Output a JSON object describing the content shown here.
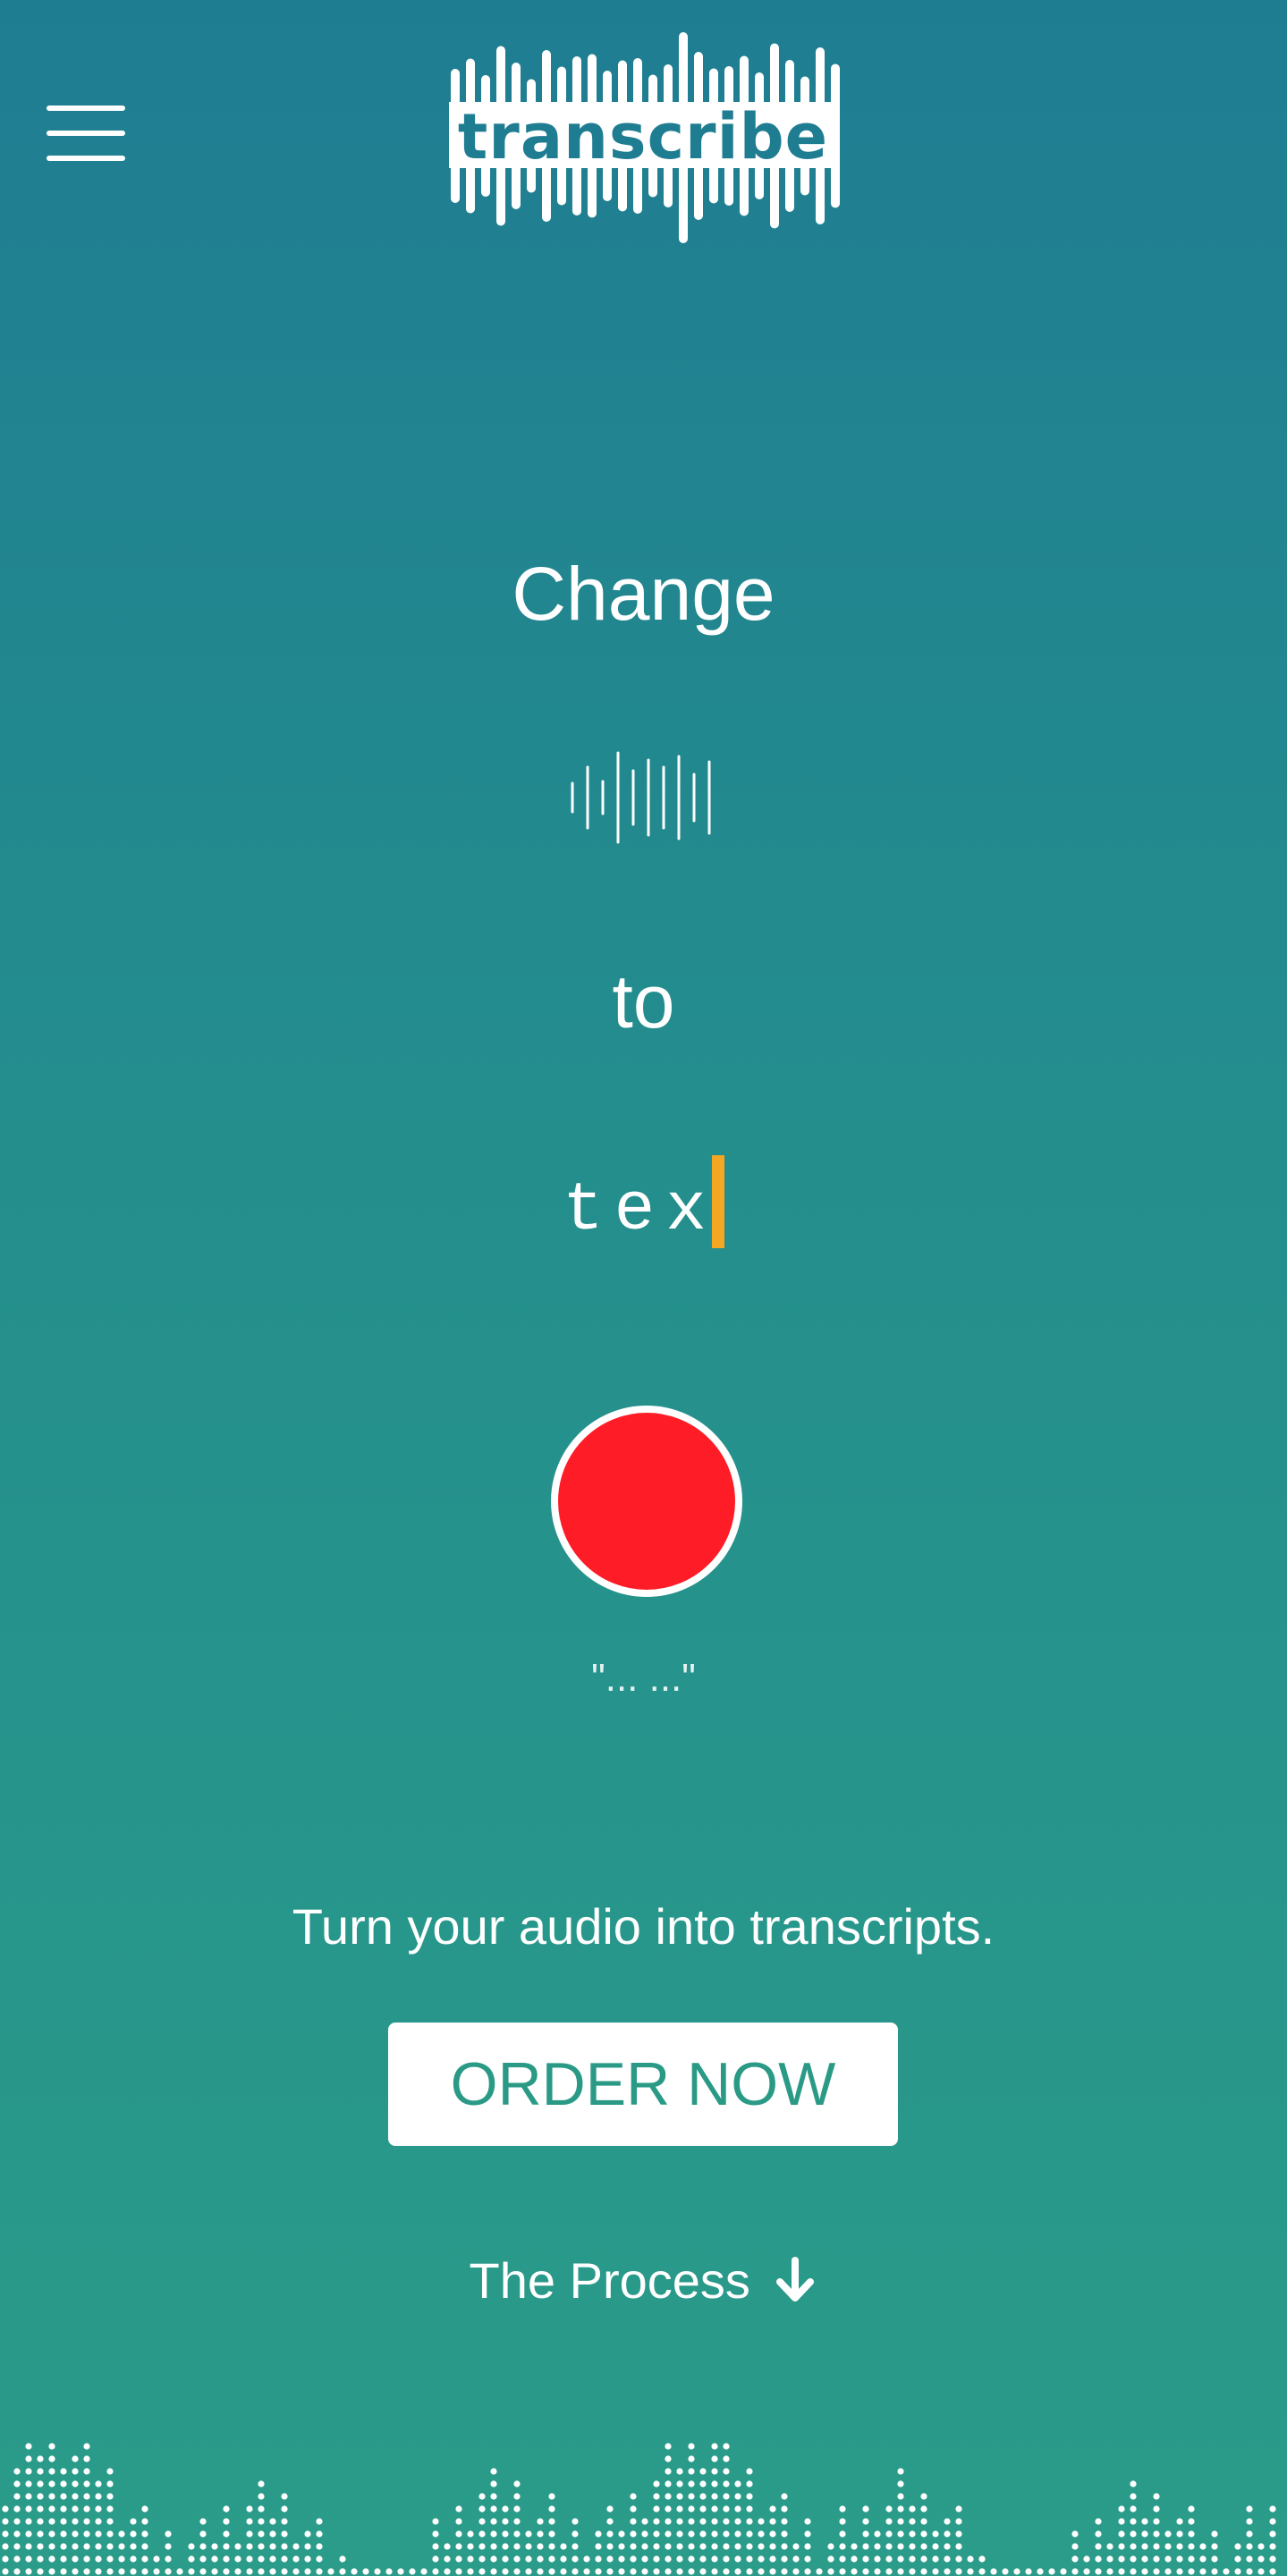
{
  "header": {
    "menu_icon": "hamburger-menu-icon",
    "logo_text": "transcribe"
  },
  "hero": {
    "line1": "Change",
    "audio_icon": "audio-waveform-icon",
    "line2": "to",
    "typed_text": "tex",
    "caret_color": "#f5a623",
    "record_icon": "record-button",
    "record_color": "#fe1c26",
    "quote_text": "\"... ...\""
  },
  "cta": {
    "tagline": "Turn your audio into transcripts.",
    "order_label": "ORDER NOW",
    "order_text_color": "#2a9a86",
    "process_label": "The Process",
    "process_icon": "arrow-down-icon"
  },
  "theme": {
    "gradient_top": "#1f7d92",
    "gradient_bottom": "#2a9c89"
  },
  "footer": {
    "decoration_icon": "equalizer-dots-icon"
  }
}
